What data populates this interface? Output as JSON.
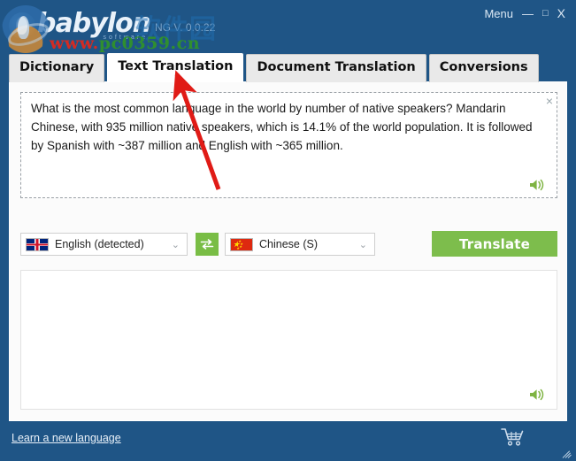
{
  "window": {
    "logo_word": "babylon",
    "logo_sub": "software",
    "version": "NG V. 0.0.22",
    "menu_label": "Menu",
    "minimize_glyph": "—",
    "maximize_glyph": "□",
    "close_glyph": "X",
    "background_color": "#1f5586"
  },
  "watermark": {
    "url_red": "www.",
    "url_rest": "pc0359.cn",
    "cn_text": "软件园"
  },
  "tabs": [
    {
      "label": "Dictionary",
      "active": false
    },
    {
      "label": "Text Translation",
      "active": true
    },
    {
      "label": "Document Translation",
      "active": false
    },
    {
      "label": "Conversions",
      "active": false
    }
  ],
  "source": {
    "text": "What is the most common language in the world by number of native speakers? Mandarin Chinese, with 935 million native speakers, which is 14.1% of the world population. It is followed by Spanish with ~387 million and English with ~365 million.",
    "placeholder": "",
    "clear_glyph": "×",
    "speak_icon": "speaker-icon"
  },
  "languages": {
    "source": {
      "label": "English (detected)",
      "flag": "uk-flag-icon"
    },
    "target": {
      "label": "Chinese (S)",
      "flag": "china-flag-icon"
    },
    "swap_icon": "swap-arrows-icon",
    "caret_glyph": "⌄"
  },
  "actions": {
    "translate_label": "Translate",
    "translate_color": "#7dbd4c",
    "swap_color": "#79bd45"
  },
  "result": {
    "text": "",
    "speak_icon": "speaker-icon"
  },
  "footer": {
    "learn_link": "Learn a new language",
    "cart_icon": "shopping-cart-icon",
    "resize_grip": "resize-grip-icon"
  },
  "annotation": {
    "arrow_color": "#e01b16"
  }
}
